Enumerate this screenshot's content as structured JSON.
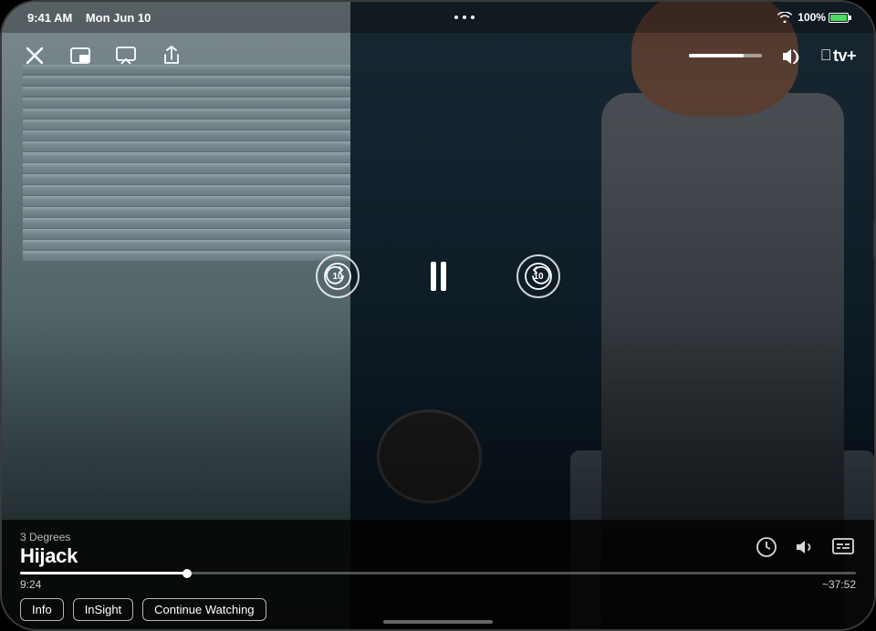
{
  "status_bar": {
    "time": "9:41 AM",
    "date": "Mon Jun 10",
    "battery_percent": "100%",
    "wifi": true
  },
  "player": {
    "show_subtitle": "3 Degrees",
    "show_title": "Hijack",
    "logo_text": "tv+",
    "time_current": "9:24",
    "time_remaining": "~37:52",
    "progress_percent": 20,
    "volume_percent": 75
  },
  "controls": {
    "close_label": "✕",
    "pip_label": "⧉",
    "airplay_label": "⬛",
    "share_label": "↑",
    "skip_back_label": "10",
    "skip_forward_label": "10",
    "pause_label": "pause",
    "playback_speed_label": "1×",
    "subtitles_label": "CC"
  },
  "action_buttons": [
    {
      "id": "info-btn",
      "label": "Info"
    },
    {
      "id": "insight-btn",
      "label": "InSight"
    },
    {
      "id": "continue-watching-btn",
      "label": "Continue Watching"
    }
  ]
}
